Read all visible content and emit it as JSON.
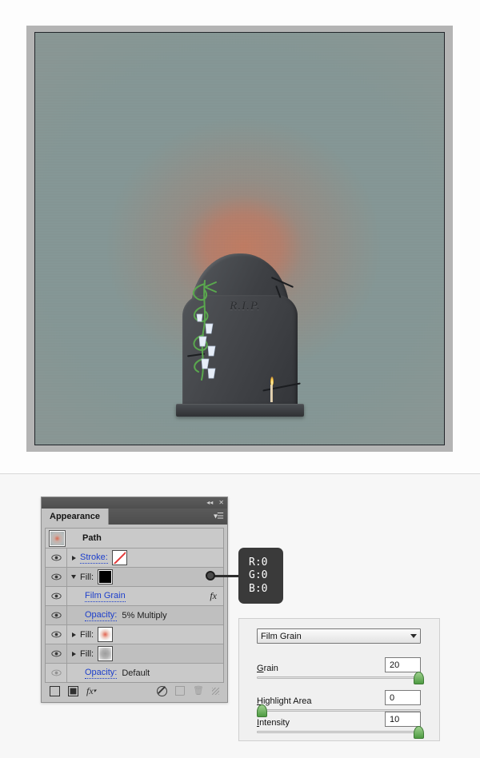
{
  "artwork": {
    "title": "tombstone-illustration",
    "rip_text": "R.I.P.",
    "background_glow_color": "#d0765a",
    "background_edge_color": "#8f9d9c",
    "stone_color": "#3e4044"
  },
  "panel": {
    "tab_label": "Appearance",
    "collapse_icon": "◂◂",
    "close_icon": "✕",
    "menu_icon": "▾☰",
    "path_label": "Path",
    "rows": [
      {
        "name": "stroke",
        "label": "Stroke:",
        "value": "",
        "swatch": "none",
        "has_triangle": true,
        "triangle": "right",
        "eye": "visible",
        "link": true
      },
      {
        "name": "fill-1",
        "label": "Fill:",
        "value": "",
        "swatch": "black",
        "has_triangle": true,
        "triangle": "down",
        "eye": "visible",
        "link": false
      },
      {
        "name": "film-grain-effect",
        "label": "Film Grain",
        "value": "",
        "swatch": "",
        "has_triangle": false,
        "triangle": "",
        "eye": "visible",
        "link": true,
        "fx": "fx"
      },
      {
        "name": "effect-opacity",
        "label": "Opacity:",
        "value": "5% Multiply",
        "swatch": "",
        "has_triangle": false,
        "triangle": "",
        "eye": "visible",
        "link": true
      },
      {
        "name": "fill-2",
        "label": "Fill:",
        "value": "",
        "swatch": "radial",
        "has_triangle": true,
        "triangle": "right",
        "eye": "visible",
        "link": false
      },
      {
        "name": "fill-3",
        "label": "Fill:",
        "value": "",
        "swatch": "graygrad",
        "has_triangle": true,
        "triangle": "right",
        "eye": "visible",
        "link": false
      },
      {
        "name": "object-opacity",
        "label": "Opacity:",
        "value": "Default",
        "swatch": "",
        "has_triangle": false,
        "triangle": "",
        "eye": "dimmed",
        "link": true
      }
    ],
    "footer": {
      "new_stroke": "new-stroke",
      "new_fill": "new-fill",
      "add_effect": "fx",
      "clear_appearance": "clear-appearance",
      "duplicate_item": "duplicate-item",
      "delete_item": "delete-item",
      "resize_grip": "resize-grip"
    }
  },
  "tooltip": {
    "r": "R:0",
    "g": "G:0",
    "b": "B:0"
  },
  "dialog": {
    "effect_name": "Film Grain",
    "controls": [
      {
        "name": "grain",
        "label": "Grain",
        "accel": "G",
        "rest": "rain",
        "value": "20",
        "percent": 100
      },
      {
        "name": "highlight-area",
        "label": "Highlight Area",
        "accel": "H",
        "rest": "ighlight Area",
        "value": "0",
        "percent": 0
      },
      {
        "name": "intensity",
        "label": "Intensity",
        "accel": "I",
        "rest": "ntensity",
        "value": "10",
        "percent": 100
      }
    ]
  }
}
